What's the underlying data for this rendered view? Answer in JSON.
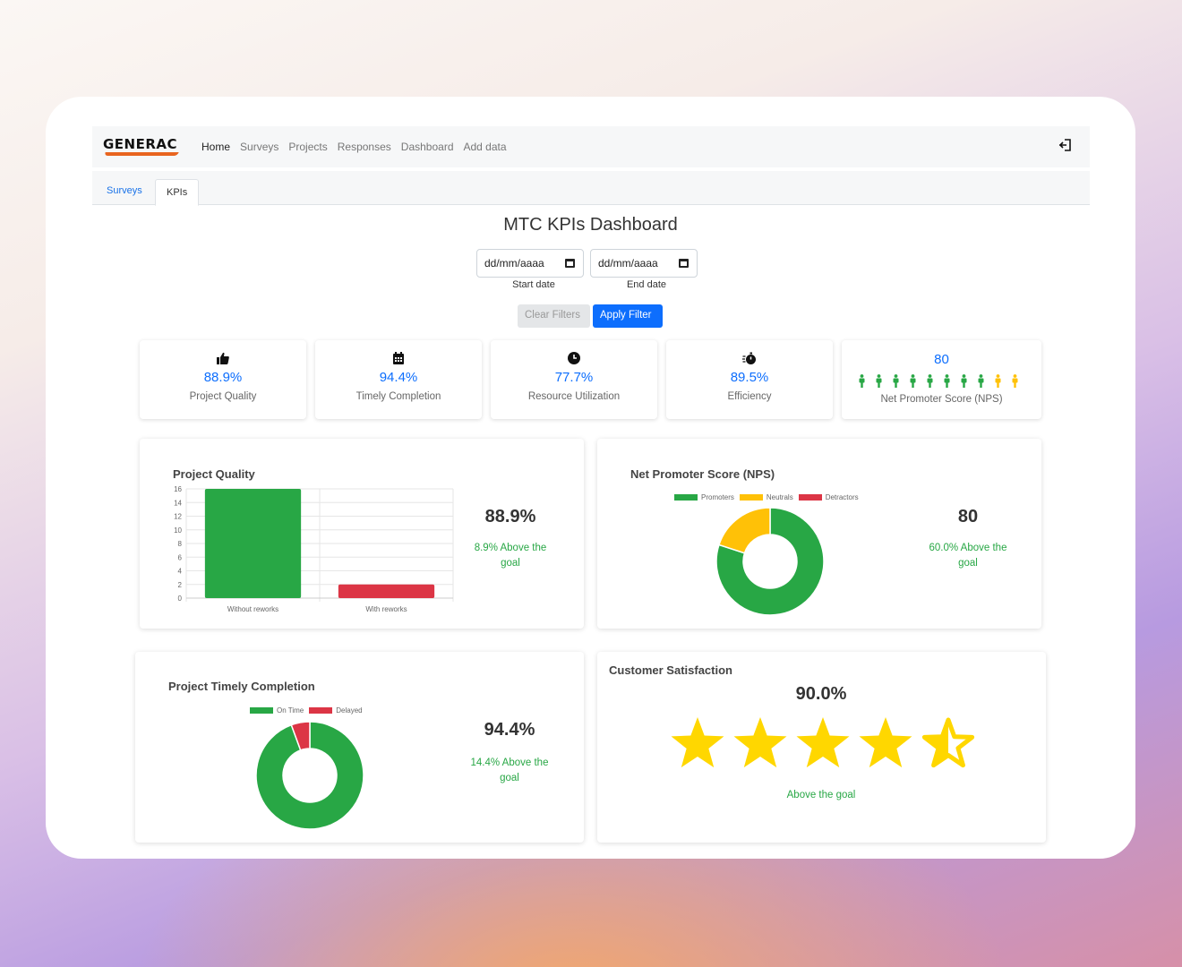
{
  "brand": "GENERAC",
  "nav": {
    "links": [
      {
        "label": "Home",
        "active": true
      },
      {
        "label": "Surveys",
        "active": false
      },
      {
        "label": "Projects",
        "active": false
      },
      {
        "label": "Responses",
        "active": false
      },
      {
        "label": "Dashboard",
        "active": false
      },
      {
        "label": "Add data",
        "active": false
      }
    ],
    "logout_icon": "logout-icon"
  },
  "tabs": [
    {
      "label": "Surveys",
      "active": false
    },
    {
      "label": "KPIs",
      "active": true
    }
  ],
  "page_title": "MTC KPIs Dashboard",
  "filters": {
    "start_placeholder": "dd/mm/aaaa",
    "end_placeholder": "dd/mm/aaaa",
    "start_label": "Start date",
    "end_label": "End date",
    "clear_label": "Clear Filters",
    "apply_label": "Apply Filter"
  },
  "kpis": [
    {
      "icon": "thumbs-up-icon",
      "value": "88.9%",
      "label": "Project Quality"
    },
    {
      "icon": "calendar-icon",
      "value": "94.4%",
      "label": "Timely Completion"
    },
    {
      "icon": "clock-icon",
      "value": "77.7%",
      "label": "Resource Utilization"
    },
    {
      "icon": "stopwatch-icon",
      "value": "89.5%",
      "label": "Efficiency"
    },
    {
      "icon": "people-icon",
      "value": "80",
      "label": "Net Promoter Score (NPS)",
      "people": {
        "green": 8,
        "yellow": 2
      }
    }
  ],
  "colors": {
    "green": "#28a745",
    "yellow": "#ffc107",
    "red": "#dc3545",
    "blue": "#0d6efd"
  },
  "cards": {
    "quality": {
      "title": "Project Quality",
      "value": "88.9%",
      "goal": "8.9% Above the goal"
    },
    "nps": {
      "title": "Net Promoter Score (NPS)",
      "value": "80",
      "goal": "60.0% Above the goal"
    },
    "timely": {
      "title": "Project Timely Completion",
      "value": "94.4%",
      "goal": "14.4% Above the goal"
    },
    "satisfaction": {
      "title": "Customer Satisfaction",
      "value": "90.0%",
      "goal": "Above the goal",
      "stars": 4.5
    }
  },
  "chart_data": [
    {
      "type": "bar",
      "title": "Project Quality",
      "categories": [
        "Without reworks",
        "With reworks"
      ],
      "values": [
        16,
        2
      ],
      "colors": [
        "#28a745",
        "#dc3545"
      ],
      "ylim": [
        0,
        16
      ],
      "yticks": [
        "0",
        "2",
        "4",
        "6",
        "8",
        "10",
        "12",
        "14",
        "16"
      ],
      "grid": true
    },
    {
      "type": "pie",
      "title": "Net Promoter Score (NPS)",
      "labels": [
        "Promoters",
        "Neutrals",
        "Detractors"
      ],
      "values": [
        80,
        20,
        0
      ],
      "colors": [
        "#28a745",
        "#ffc107",
        "#dc3545"
      ],
      "legend": "top"
    },
    {
      "type": "pie",
      "title": "Project Timely Completion",
      "labels": [
        "On Time",
        "Delayed"
      ],
      "values": [
        94.4,
        5.6
      ],
      "colors": [
        "#28a745",
        "#dc3545"
      ],
      "legend": "top"
    }
  ]
}
